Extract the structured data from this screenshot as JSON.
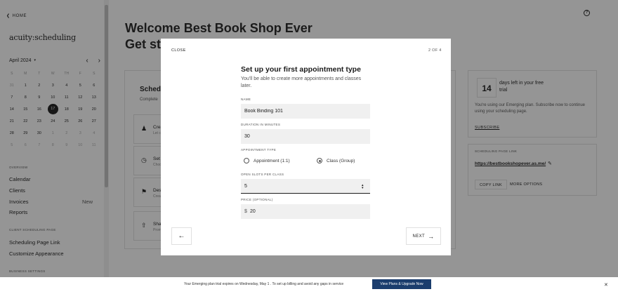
{
  "sidebar": {
    "home_label": "HOME",
    "logo": "acuity:scheduling",
    "calendar": {
      "month": "April 2024",
      "dow": [
        "S",
        "M",
        "T",
        "W",
        "TH",
        "F",
        "S"
      ],
      "weeks": [
        [
          "31",
          "1",
          "2",
          "3",
          "4",
          "5",
          "6"
        ],
        [
          "7",
          "8",
          "9",
          "10",
          "11",
          "12",
          "13"
        ],
        [
          "14",
          "15",
          "16",
          "17",
          "18",
          "19",
          "20"
        ],
        [
          "21",
          "22",
          "23",
          "24",
          "25",
          "26",
          "27"
        ],
        [
          "28",
          "29",
          "30",
          "1",
          "2",
          "3",
          "4"
        ],
        [
          "5",
          "6",
          "7",
          "8",
          "9",
          "10",
          "11"
        ]
      ],
      "selected": "17"
    },
    "overview_label": "OVERVIEW",
    "nav": [
      {
        "label": "Calendar"
      },
      {
        "label": "Clients"
      },
      {
        "label": "Invoices",
        "badge": "New"
      },
      {
        "label": "Reports"
      }
    ],
    "client_section_label": "CLIENT SCHEDULING PAGE",
    "client_nav": [
      {
        "label": "Scheduling Page Link"
      },
      {
        "label": "Customize Appearance"
      }
    ],
    "business_section_label": "BUSINESS SETTINGS"
  },
  "main": {
    "welcome_line1": "Welcome Best Book Shop Ever",
    "welcome_line2": "Get sta",
    "schedule_card": {
      "title": "Sched",
      "subtitle": "Complete",
      "tasks": [
        {
          "icon": "people-icon",
          "title": "Crea",
          "desc": "Let cl"
        },
        {
          "icon": "clock-icon",
          "title": "Set y",
          "desc": "Choo"
        },
        {
          "icon": "tag-icon",
          "title": "Des",
          "desc": "Crea"
        },
        {
          "icon": "share-icon",
          "title": "Sha",
          "desc": "Prom"
        }
      ]
    },
    "trial_card": {
      "days": "14",
      "text": "days left in your free trial",
      "desc": "You're using our Emerging plan. Subscribe now to continue using your scheduling page.",
      "subscribe": "SUBSCRIBE"
    },
    "link_card": {
      "label": "SCHEDULING PAGE LINK",
      "url": "https://bestbookshopever.as.me/",
      "copy": "COPY LINK",
      "more": "MORE OPTIONS"
    }
  },
  "modal": {
    "close": "CLOSE",
    "step": "2 OF 4",
    "title": "Set up your first appointment type",
    "desc": "You'll be able to create more appointments and classes later.",
    "name_label": "NAME",
    "name_value": "Book Binding 101",
    "duration_label": "DURATION IN MINUTES",
    "duration_value": "30",
    "type_label": "APPOINTMENT TYPE",
    "type_options": [
      "Appointment (1:1)",
      "Class (Group)"
    ],
    "type_selected": "Class (Group)",
    "slots_label": "OPEN SLOTS PER CLASS",
    "slots_value": "5",
    "price_label": "PRICE (OPTIONAL)",
    "price_prefix": "$",
    "price_value": "20",
    "next": "NEXT"
  },
  "banner": {
    "message": "Your Emerging plan trial expires on Wednesday, May 1 . To set up billing and avoid any gaps in service",
    "button": "View Plans & Upgrade Now"
  }
}
